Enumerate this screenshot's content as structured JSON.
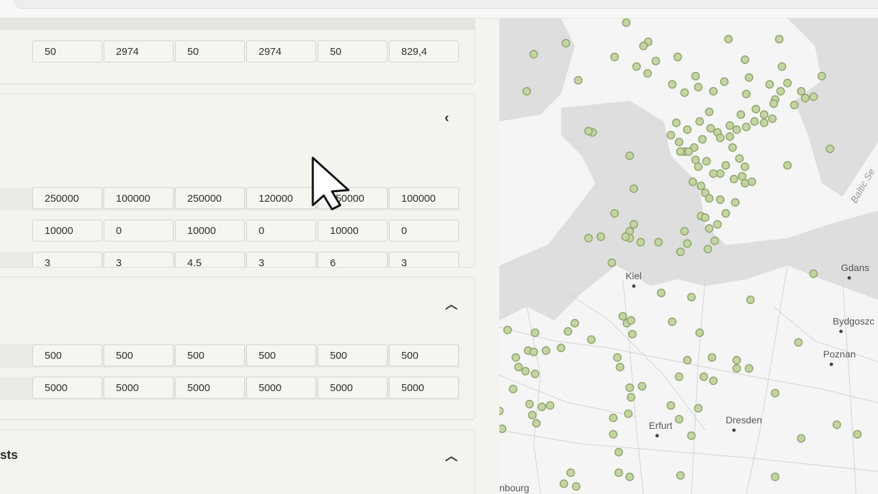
{
  "top_table": {
    "rows": [
      [
        "50",
        "2974",
        "50",
        "2974",
        "50",
        "829,4"
      ]
    ]
  },
  "middle_section": {
    "rows": [
      [
        "250000",
        "100000",
        "250000",
        "120000",
        "250000",
        "100000"
      ],
      [
        "10000",
        "0",
        "10000",
        "0",
        "10000",
        "0"
      ],
      [
        "3",
        "3",
        "4.5",
        "3",
        "6",
        "3"
      ]
    ],
    "toggle_icon": "chevron-left-icon"
  },
  "lower_section": {
    "rows": [
      [
        "500",
        "500",
        "500",
        "500",
        "500",
        "500"
      ],
      [
        "5000",
        "5000",
        "5000",
        "5000",
        "5000",
        "5000"
      ]
    ],
    "toggle_icon": "chevron-up-icon"
  },
  "bottom_section": {
    "title_fragment": "sts",
    "toggle_icon": "chevron-up-icon"
  },
  "map": {
    "labels": {
      "kiel": "Kiel",
      "gdansk": "Gdans",
      "bydgoszcz": "Bydgoszc",
      "poznan": "Poznan",
      "erfurt": "Erfurt",
      "dresden": "Dresden",
      "hamburg": "nbourg",
      "baltic": "Baltic Se"
    },
    "colors": {
      "land": "#f5f5f5",
      "water": "#dedede",
      "marker_fill": "#c3d5a3",
      "marker_stroke": "#8fa46b"
    }
  }
}
